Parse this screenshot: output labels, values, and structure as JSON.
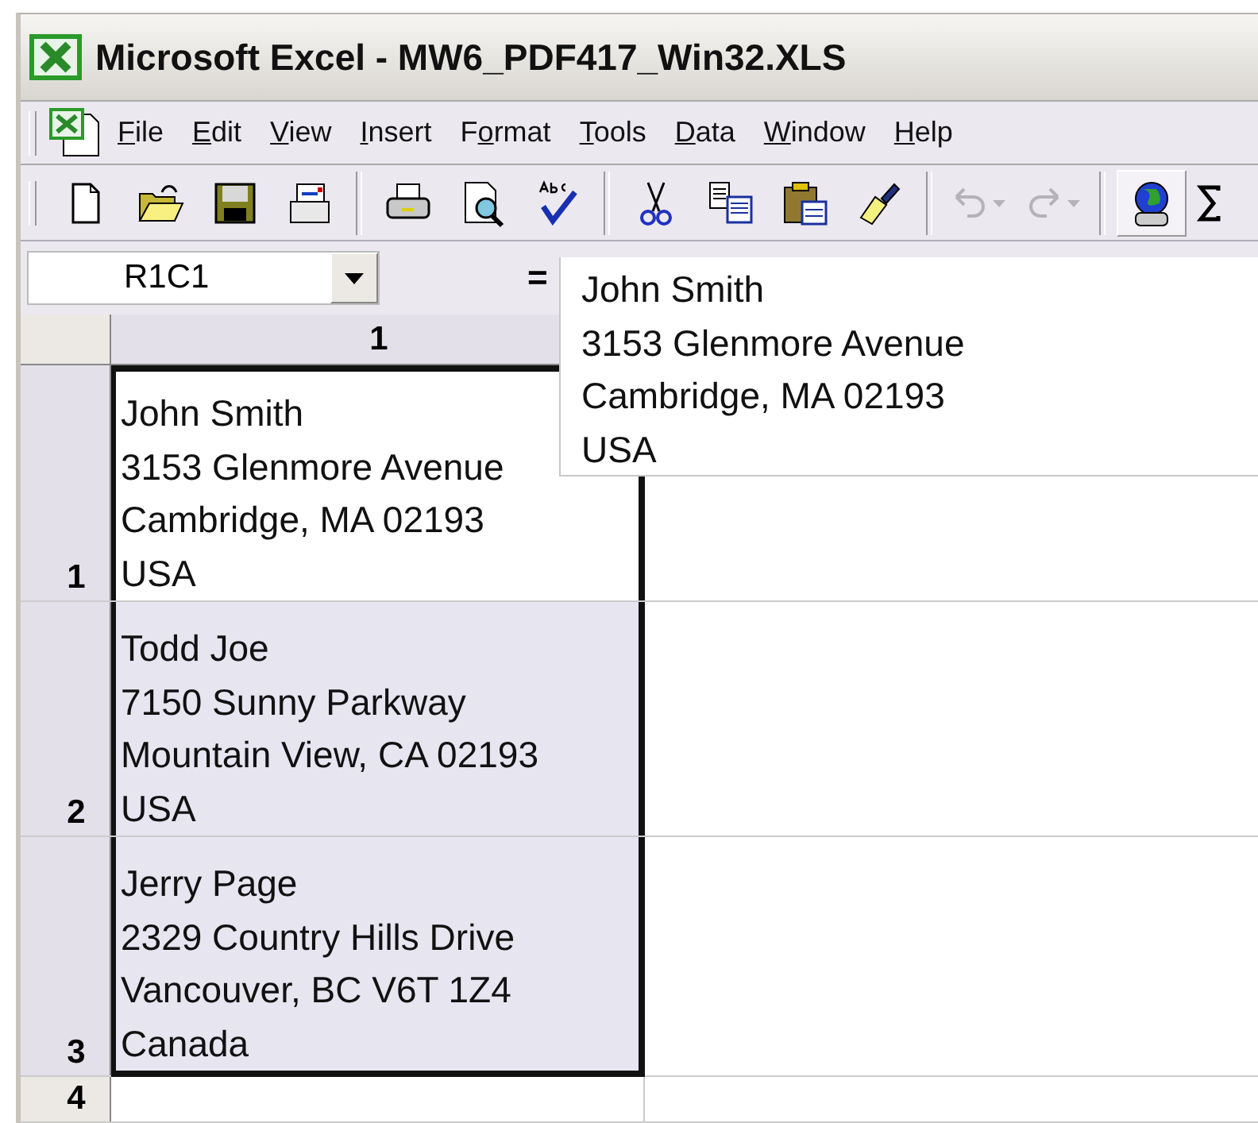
{
  "window": {
    "title": "Microsoft Excel - MW6_PDF417_Win32.XLS"
  },
  "menu": [
    {
      "key": "F",
      "post": "ile"
    },
    {
      "key": "E",
      "post": "dit"
    },
    {
      "key": "V",
      "post": "iew"
    },
    {
      "key": "I",
      "post": "nsert"
    },
    {
      "pre": "F",
      "key": "o",
      "post": "rmat"
    },
    {
      "key": "T",
      "post": "ools"
    },
    {
      "key": "D",
      "post": "ata"
    },
    {
      "key": "W",
      "post": "indow"
    },
    {
      "key": "H",
      "post": "elp"
    }
  ],
  "toolbar": [
    {
      "kind": "new",
      "disabled": false,
      "pressed": false
    },
    {
      "kind": "open",
      "disabled": false,
      "pressed": false
    },
    {
      "kind": "save",
      "disabled": false,
      "pressed": false
    },
    {
      "kind": "mail",
      "disabled": false,
      "pressed": false
    },
    {
      "kind": "separator"
    },
    {
      "kind": "print",
      "disabled": false,
      "pressed": false
    },
    {
      "kind": "preview",
      "disabled": false,
      "pressed": false
    },
    {
      "kind": "spelling",
      "disabled": false,
      "pressed": false
    },
    {
      "kind": "separator"
    },
    {
      "kind": "cut",
      "disabled": false,
      "pressed": false
    },
    {
      "kind": "copy",
      "disabled": false,
      "pressed": false
    },
    {
      "kind": "paste",
      "disabled": false,
      "pressed": false
    },
    {
      "kind": "brush",
      "disabled": false,
      "pressed": false
    },
    {
      "kind": "separator"
    },
    {
      "kind": "undo",
      "disabled": true,
      "pressed": false
    },
    {
      "kind": "redo",
      "disabled": true,
      "pressed": false
    },
    {
      "kind": "separator"
    },
    {
      "kind": "web",
      "disabled": false,
      "pressed": true
    },
    {
      "kind": "sum",
      "disabled": false,
      "pressed": false
    }
  ],
  "formula_bar": {
    "name_box": "R1C1",
    "equals": "=",
    "lines": [
      "John Smith",
      "3153 Glenmore Avenue",
      "Cambridge, MA 02193",
      "USA"
    ]
  },
  "columns": [
    "1"
  ],
  "rows": [
    {
      "header": "1",
      "selected": true,
      "active": true,
      "lines": [
        "John Smith",
        "3153 Glenmore Avenue",
        "Cambridge, MA 02193",
        "USA"
      ]
    },
    {
      "header": "2",
      "selected": true,
      "active": false,
      "lines": [
        "Todd Joe",
        "7150 Sunny Parkway",
        "Mountain View, CA 02193",
        "USA"
      ]
    },
    {
      "header": "3",
      "selected": true,
      "active": false,
      "lines": [
        "Jerry Page",
        "2329 Country Hills Drive",
        "Vancouver, BC V6T 1Z4",
        "Canada"
      ]
    },
    {
      "header": "4",
      "selected": false,
      "lines": []
    }
  ]
}
